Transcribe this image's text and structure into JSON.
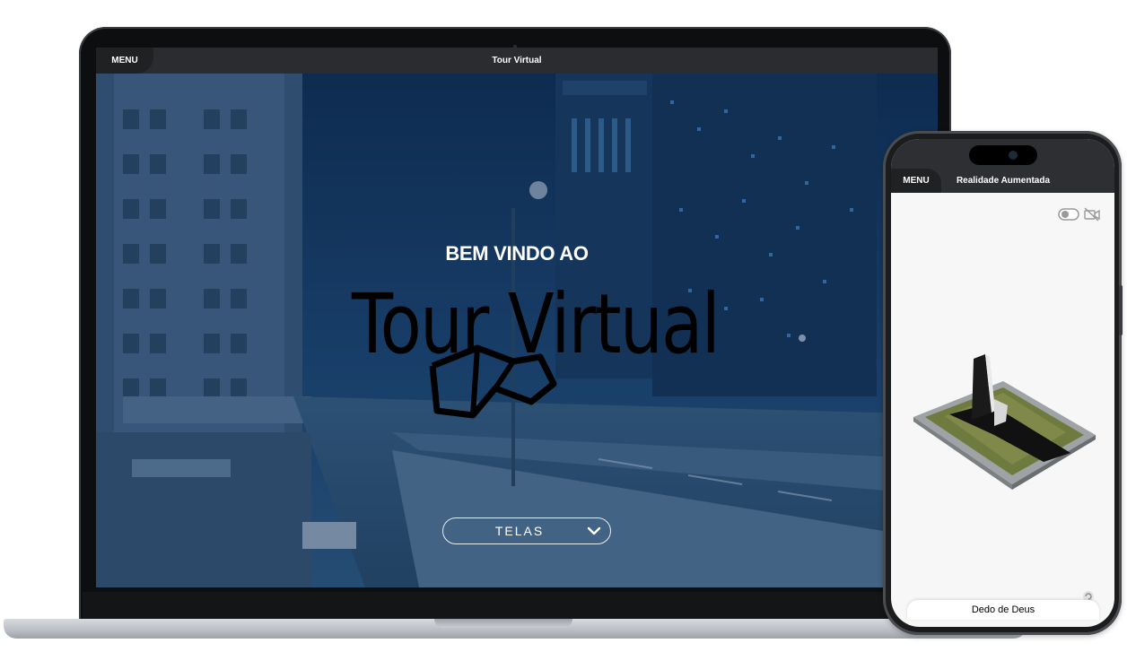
{
  "laptop": {
    "menu_label": "MENU",
    "title": "Tour Virtual",
    "welcome_heading": "BEM VINDO AO",
    "logo_text": "Tour Virtual",
    "dropdown": {
      "selected": "TELAS"
    }
  },
  "phone": {
    "menu_label": "MENU",
    "title": "Realidade Aumentada",
    "model_caption": "Dedo de Deus"
  },
  "colors": {
    "topbar": "#2a2c2f",
    "menu_tab": "#1f2123",
    "screen_tint": "#143c6e",
    "phone_screen": "#f7f7f7"
  },
  "icons": [
    "chevron-down-icon",
    "toggle-switch-icon",
    "camera-off-icon",
    "reload-icon"
  ]
}
